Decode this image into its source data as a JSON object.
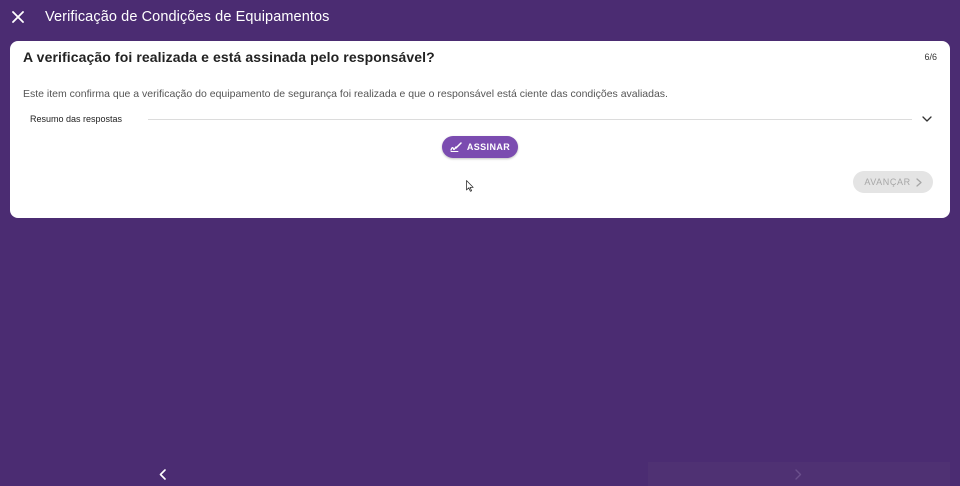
{
  "appbar": {
    "title": "Verificação de Condições de Equipamentos",
    "close_icon": "close-icon"
  },
  "card": {
    "question": "A verificação foi realizada e está assinada pelo responsável?",
    "counter": "6/6",
    "description": "Este item confirma que a verificação do equipamento de segurança foi realizada e que o responsável está ciente das condições avaliadas.",
    "summary_label": "Resumo das respostas",
    "sign_label": "ASSINAR",
    "sign_icon": "signature-icon",
    "advance_label": "AVANÇAR",
    "advance_icon": "chevron-right-icon"
  },
  "footer": {
    "prev_icon": "chevron-left-icon",
    "next_icon": "chevron-right-icon"
  },
  "colors": {
    "background": "#4b2c72",
    "primary": "#7b4cb0",
    "card": "#ffffff",
    "disabled": "#e4e4e4"
  }
}
